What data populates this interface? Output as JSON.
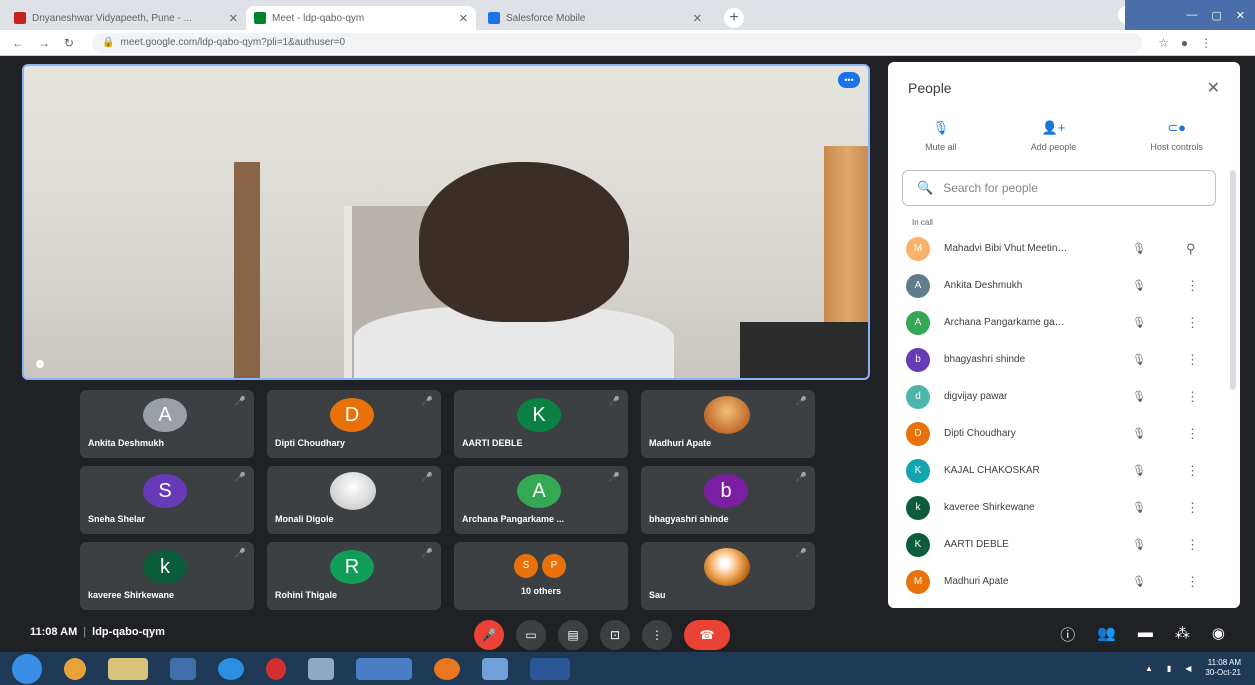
{
  "browser": {
    "tabs": [
      {
        "title": "Dnyaneshwar Vidyapeeth, Pune - ...",
        "favicon_color": "#c5221f"
      },
      {
        "title": "Meet - ldp-qabo-qym",
        "favicon_color": "#00832d"
      },
      {
        "title": "Salesforce Mobile",
        "favicon_color": "#1a73e8"
      }
    ],
    "new_tab": "+",
    "url": "meet.google.com/ldp-qabo-qym?pli=1&authuser=0"
  },
  "meeting": {
    "time": "11:08 AM",
    "code": "ldp-qabo-qym"
  },
  "tiles": [
    {
      "name": "Ankita Deshmukh",
      "initial": "A",
      "color": "#9aa0a6"
    },
    {
      "name": "Dipti Choudhary",
      "initial": "D",
      "color": "#e8710a"
    },
    {
      "name": "AARTI DEBLE",
      "initial": "K",
      "color": "#0b8043"
    },
    {
      "name": "Madhuri Apate",
      "initial": "",
      "color": "#c06a2b"
    },
    {
      "name": "Sneha Shelar",
      "initial": "S",
      "color": "#673ab7"
    },
    {
      "name": "Monali Digole",
      "initial": "",
      "color": "#e0e0e0"
    },
    {
      "name": "Archana Pangarkame ...",
      "initial": "A",
      "color": "#34a853"
    },
    {
      "name": "bhagyashri shinde",
      "initial": "b",
      "color": "#7b1fa2"
    },
    {
      "name": "kaveree Shirkewane",
      "initial": "k",
      "color": "#0b5d3b"
    },
    {
      "name": "Rohini Thigale",
      "initial": "R",
      "color": "#0f9d58"
    },
    {
      "name": "10 others",
      "initial": "",
      "color": "#e8710a"
    },
    {
      "name": "Sau",
      "initial": "",
      "color": "#f6b26b"
    }
  ],
  "others_avatars": [
    {
      "initial": "S",
      "color": "#e8710a"
    },
    {
      "initial": "P",
      "color": "#e8710a"
    }
  ],
  "panel": {
    "title": "People",
    "actions": [
      {
        "label": "Mute all",
        "icon": "mic-off-icon"
      },
      {
        "label": "Add people",
        "icon": "person-add-icon"
      },
      {
        "label": "Host controls",
        "icon": "toggle-icon"
      }
    ],
    "search_placeholder": "Search for people",
    "section": "In call",
    "people": [
      {
        "name": "Mahadvi Bibi Vhut Meeting host",
        "initial": "M",
        "color": "#f6b26b"
      },
      {
        "name": "Ankita Deshmukh",
        "initial": "A",
        "color": "#607d8b"
      },
      {
        "name": "Archana Pangarkame gadi...",
        "initial": "A",
        "color": "#34a853"
      },
      {
        "name": "bhagyashri shinde",
        "initial": "b",
        "color": "#673ab7"
      },
      {
        "name": "digvijay pawar",
        "initial": "d",
        "color": "#4db6ac"
      },
      {
        "name": "Dipti Choudhary",
        "initial": "D",
        "color": "#e8710a"
      },
      {
        "name": "KAJAL CHAKOSKAR",
        "initial": "K",
        "color": "#12a4af"
      },
      {
        "name": "kaveree Shirkewane",
        "initial": "k",
        "color": "#0b5d3b"
      },
      {
        "name": "AARTI DEBLE",
        "initial": "K",
        "color": "#0b5d3b"
      },
      {
        "name": "Madhuri Apate",
        "initial": "M",
        "color": "#e8710a"
      }
    ]
  },
  "taskbar": {
    "time": "11:08 AM",
    "date": "30-Oct-21"
  }
}
